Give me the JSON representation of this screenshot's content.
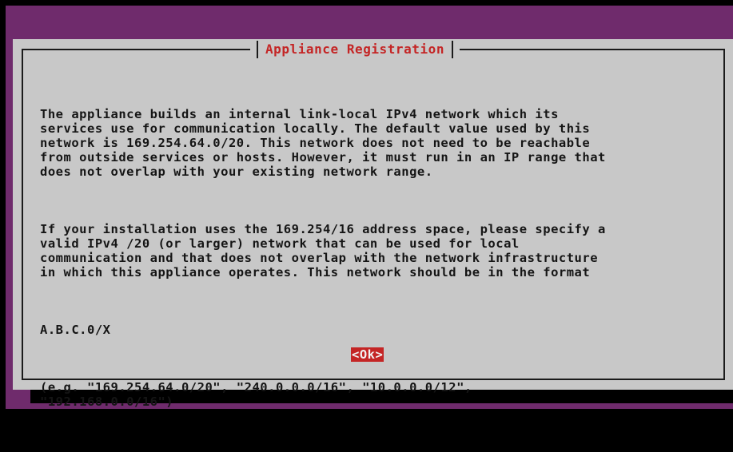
{
  "dialog": {
    "title": "Appliance Registration",
    "paragraphs": [
      "The appliance builds an internal link-local IPv4 network which its\nservices use for communication locally. The default value used by this\nnetwork is 169.254.64.0/20. This network does not need to be reachable\nfrom outside services or hosts. However, it must run in an IP range that\ndoes not overlap with your existing network range.",
      "If your installation uses the 169.254/16 address space, please specify a\nvalid IPv4 /20 (or larger) network that can be used for local\ncommunication and that does not overlap with the network infrastructure\nin which this appliance operates. This network should be in the format",
      "A.B.C.0/X",
      "(e.g. \"169.254.64.0/20\", \"240.0.0.0/16\", \"10.0.0.0/12\",\n\"192.168.0.0/16\")"
    ],
    "ok_label": "<Ok>"
  },
  "colors": {
    "background": "#6f2b6c",
    "dialog": "#c8c8c8",
    "accent": "#c42525",
    "text": "#151515"
  }
}
